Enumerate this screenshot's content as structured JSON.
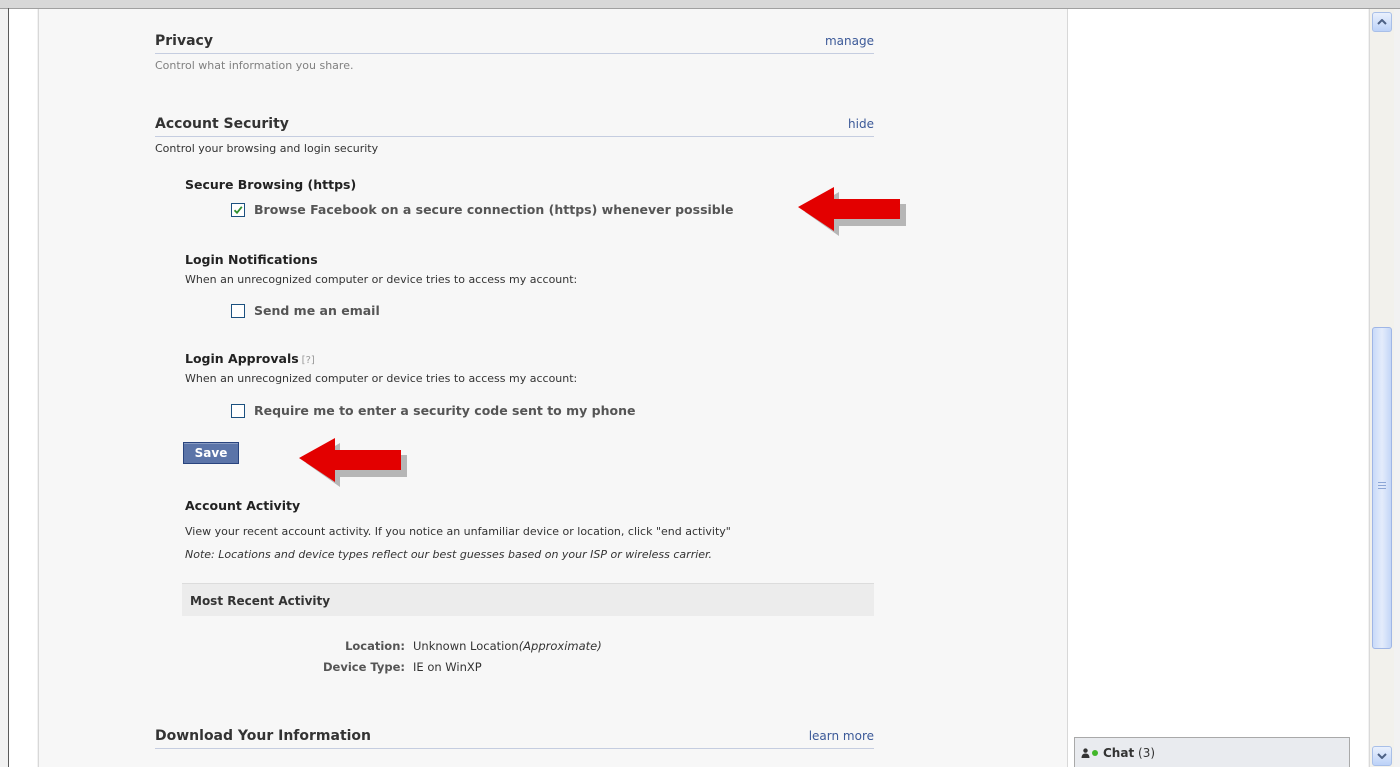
{
  "privacy": {
    "title": "Privacy",
    "link": "manage",
    "description": "Control what information you share."
  },
  "account_security": {
    "title": "Account Security",
    "link": "hide",
    "description": "Control your browsing and login security",
    "secure_browsing": {
      "title": "Secure Browsing (https)",
      "checkbox_label": "Browse Facebook on a secure connection (https) whenever possible",
      "checked": true
    },
    "login_notifications": {
      "title": "Login Notifications",
      "text": "When an unrecognized computer or device tries to access my account:",
      "checkbox_label": "Send me an email",
      "checked": false
    },
    "login_approvals": {
      "title": "Login Approvals",
      "help": "[?]",
      "text": "When an unrecognized computer or device tries to access my account:",
      "checkbox_label": "Require me to enter a security code sent to my phone",
      "checked": false
    },
    "save_label": "Save",
    "account_activity": {
      "title": "Account Activity",
      "text": "View your recent account activity. If you notice an unfamiliar device or location, click \"end activity\"",
      "note": "Note: Locations and device types reflect our best guesses based on your ISP or wireless carrier.",
      "recent_header": "Most Recent Activity",
      "location_key": "Location:",
      "location_value": "Unknown Location",
      "location_qualifier": "(Approximate)",
      "device_key": "Device Type:",
      "device_value": "IE on WinXP"
    }
  },
  "download": {
    "title": "Download Your Information",
    "link": "learn more"
  },
  "chat": {
    "label": "Chat",
    "count": "(3)"
  },
  "colors": {
    "link": "#3b5998",
    "save_button": "#5b74a8",
    "arrow": "#e30000",
    "online_dot": "#42b72a"
  }
}
